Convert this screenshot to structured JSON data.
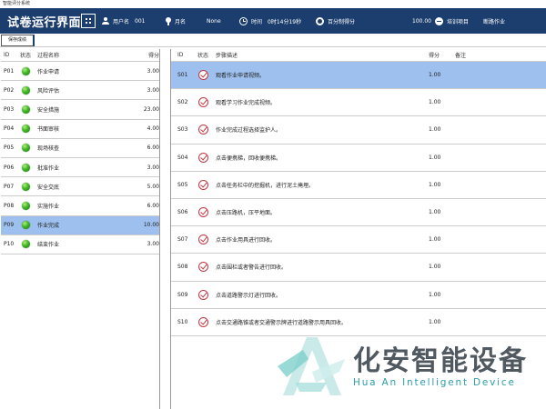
{
  "app": {
    "window_title": "智能评分系统"
  },
  "header": {
    "title": "试卷运行界面",
    "username_label": "用户名",
    "username_value": "001",
    "name_label": "月名",
    "name_value": "None",
    "time_label": "时间",
    "time_value": "0时14分19秒",
    "score_label": "百分制得分",
    "score_value": "100.00",
    "project_label": "培训项目",
    "project_value": "断路作业"
  },
  "toolbar": {
    "save_label": "保存成绩"
  },
  "left_table": {
    "columns": [
      "ID",
      "状态",
      "过程名称",
      "得分"
    ],
    "rows": [
      {
        "id": "P01",
        "name": "作业申请",
        "score": "3.00"
      },
      {
        "id": "P02",
        "name": "风险评估",
        "score": "3.00"
      },
      {
        "id": "P03",
        "name": "安全措施",
        "score": "23.00"
      },
      {
        "id": "P04",
        "name": "书面审核",
        "score": "4.00"
      },
      {
        "id": "P05",
        "name": "现场核查",
        "score": "6.00"
      },
      {
        "id": "P06",
        "name": "批准作业",
        "score": "3.00"
      },
      {
        "id": "P07",
        "name": "安全交底",
        "score": "5.00"
      },
      {
        "id": "P08",
        "name": "实施作业",
        "score": "6.00"
      },
      {
        "id": "P09",
        "name": "作业完成",
        "score": "10.00"
      },
      {
        "id": "P10",
        "name": "结束作业",
        "score": "3.00"
      }
    ],
    "selected_index": 8
  },
  "right_table": {
    "columns": [
      "ID",
      "状态",
      "步骤描述",
      "得分",
      "备注"
    ],
    "rows": [
      {
        "id": "S01",
        "desc": "观看作业申请视频。",
        "score": "1.00",
        "note": ""
      },
      {
        "id": "S02",
        "desc": "观看学习作业完成视频。",
        "score": "1.00",
        "note": ""
      },
      {
        "id": "S03",
        "desc": "作业完成过程选择监护人。",
        "score": "1.00",
        "note": ""
      },
      {
        "id": "S04",
        "desc": "点击便携梯，回收便携梯。",
        "score": "1.00",
        "note": ""
      },
      {
        "id": "S05",
        "desc": "点击任务栏中的挖掘机，进行泥土掩埋。",
        "score": "1.00",
        "note": ""
      },
      {
        "id": "S06",
        "desc": "点击压路机，压平地面。",
        "score": "1.00",
        "note": ""
      },
      {
        "id": "S07",
        "desc": "点击作业用具进行回收。",
        "score": "1.00",
        "note": ""
      },
      {
        "id": "S08",
        "desc": "点击围栏或者警告进行回收。",
        "score": "1.00",
        "note": ""
      },
      {
        "id": "S09",
        "desc": "点击道路警示灯进行回收。",
        "score": "1.00",
        "note": ""
      },
      {
        "id": "S10",
        "desc": "点击交通路锥或者交通警示牌进行道路警示用具回收。",
        "score": "1.00",
        "note": ""
      }
    ],
    "selected_index": 0
  },
  "watermark": {
    "company_cn": "化安智能设备",
    "company_en": "Hua An Intelligent Device"
  },
  "colors": {
    "header_bg": "#1c3e6e",
    "selected_row": "#9dc0ee",
    "status_green": "#3fb622",
    "check_red": "#c23a44",
    "watermark_teal": "#2a9fa6"
  },
  "icons": {
    "header": [
      "qr-code-icon",
      "user-icon",
      "pin-icon",
      "clock-icon",
      "score-icon",
      "project-icon"
    ],
    "left_status": "green-dot-icon",
    "right_status": "checkmark-circle-icon"
  }
}
